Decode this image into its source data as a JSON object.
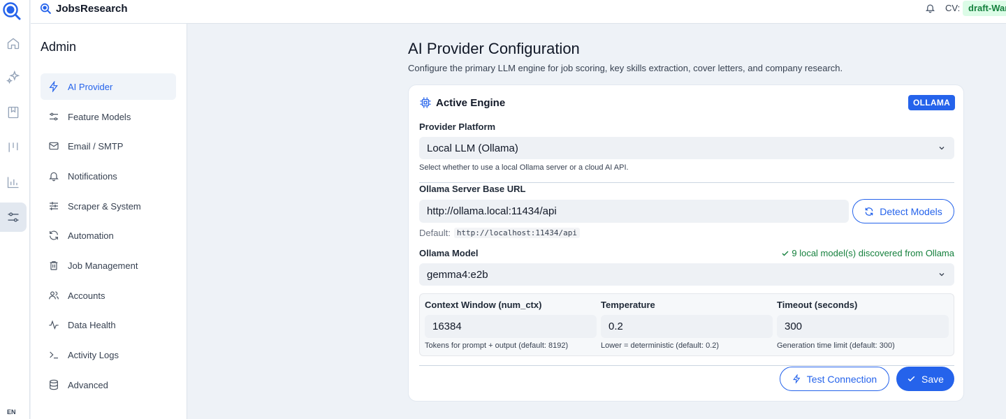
{
  "app": {
    "name": "JobsResearch",
    "lang": "EN"
  },
  "rail": {
    "icons": [
      "home-icon",
      "sparkles-icon",
      "bookmark-icon",
      "kanban-icon",
      "chart-icon",
      "sliders-icon"
    ],
    "active": "sliders-icon"
  },
  "topbar": {
    "cv_label": "CV:",
    "cv_value": "draft-War"
  },
  "admin": {
    "title": "Admin",
    "items": [
      {
        "label": "AI Provider",
        "icon": "bolt-icon"
      },
      {
        "label": "Feature Models",
        "icon": "sliders-icon"
      },
      {
        "label": "Email / SMTP",
        "icon": "mail-icon"
      },
      {
        "label": "Notifications",
        "icon": "bell-icon"
      },
      {
        "label": "Scraper & System",
        "icon": "tune-icon"
      },
      {
        "label": "Automation",
        "icon": "refresh-icon"
      },
      {
        "label": "Job Management",
        "icon": "trash-icon"
      },
      {
        "label": "Accounts",
        "icon": "users-icon"
      },
      {
        "label": "Data Health",
        "icon": "activity-icon"
      },
      {
        "label": "Activity Logs",
        "icon": "terminal-icon"
      },
      {
        "label": "Advanced",
        "icon": "database-icon"
      }
    ],
    "active_index": 0
  },
  "main": {
    "title": "AI Provider Configuration",
    "subtitle": "Configure the primary LLM engine for job scoring, key skills extraction, cover letters, and company research."
  },
  "card": {
    "title": "Active Engine",
    "badge": "OLLAMA",
    "platform": {
      "label": "Provider Platform",
      "value": "Local LLM (Ollama)",
      "hint": "Select whether to use a local Ollama server or a cloud AI API."
    },
    "base_url": {
      "label": "Ollama Server Base URL",
      "value": "http://ollama.local:11434/api",
      "default_label": "Default:",
      "default_value": "http://localhost:11434/api",
      "detect_label": "Detect Models"
    },
    "model": {
      "label": "Ollama Model",
      "status": "9 local model(s) discovered from Ollama",
      "value": "gemma4:e2b"
    },
    "params": {
      "context": {
        "label": "Context Window (num_ctx)",
        "value": "16384",
        "hint": "Tokens for prompt + output (default: 8192)"
      },
      "temperature": {
        "label": "Temperature",
        "value": "0.2",
        "hint": "Lower = deterministic (default: 0.2)"
      },
      "timeout": {
        "label": "Timeout (seconds)",
        "value": "300",
        "hint": "Generation time limit (default: 300)"
      }
    },
    "actions": {
      "test": "Test Connection",
      "save": "Save"
    }
  },
  "colors": {
    "accent": "#2563eb",
    "success": "#15803d",
    "success_bg": "#dcfce7"
  }
}
